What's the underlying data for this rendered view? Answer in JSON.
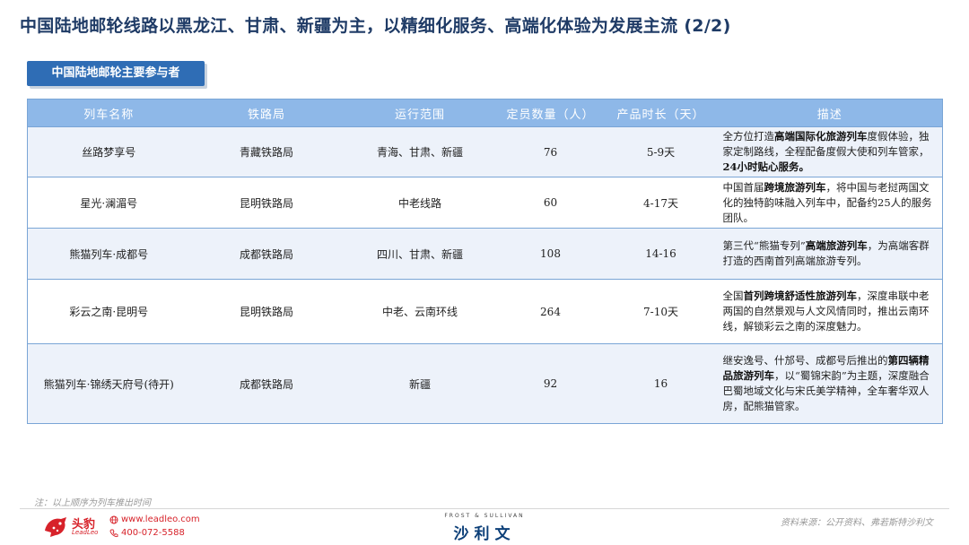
{
  "page": {
    "title": "中国陆地邮轮线路以黑龙江、甘肃、新疆为主，以精细化服务、高端化体验为发展主流 (2/2)",
    "section_label": "中国陆地邮轮主要参与者"
  },
  "table": {
    "headers": [
      "列车名称",
      "铁路局",
      "运行范围",
      "定员数量（人）",
      "产品时长（天）",
      "描述"
    ],
    "rows": [
      {
        "name": "丝路梦享号",
        "bureau": "青藏铁路局",
        "range": "青海、甘肃、新疆",
        "capacity": "76",
        "duration": "5-9天",
        "desc": [
          {
            "t": "全方位打造",
            "b": false
          },
          {
            "t": "高端国际化旅游列车",
            "b": true
          },
          {
            "t": "度假体验，独家定制路线，全程配备度假大使和列车管家，",
            "b": false
          },
          {
            "t": "24小时贴心服务。",
            "b": true
          }
        ]
      },
      {
        "name": "星光·澜湄号",
        "bureau": "昆明铁路局",
        "range": "中老线路",
        "capacity": "60",
        "duration": "4-17天",
        "desc": [
          {
            "t": "中国首届",
            "b": false
          },
          {
            "t": "跨境旅游列车",
            "b": true
          },
          {
            "t": "，将中国与老挝两国文化的独特韵味融入列车中，配备约25人的服务团队。",
            "b": false
          }
        ]
      },
      {
        "name": "熊猫列车·成都号",
        "bureau": "成都铁路局",
        "range": "四川、甘肃、新疆",
        "capacity": "108",
        "duration": "14-16",
        "desc": [
          {
            "t": "第三代“熊猫专列”",
            "b": false
          },
          {
            "t": "高端旅游列车",
            "b": true
          },
          {
            "t": "，为高端客群打造的西南首列高端旅游专列。",
            "b": false
          }
        ]
      },
      {
        "name": "彩云之南·昆明号",
        "bureau": "昆明铁路局",
        "range": "中老、云南环线",
        "capacity": "264",
        "duration": "7-10天",
        "desc": [
          {
            "t": "全国",
            "b": false
          },
          {
            "t": "首列跨境舒适性旅游列车",
            "b": true
          },
          {
            "t": "，深度串联中老两国的自然景观与人文风情同时，推出云南环线，解锁彩云之南的深度魅力。",
            "b": false
          }
        ]
      },
      {
        "name": "熊猫列车·锦绣天府号(待开)",
        "bureau": "成都铁路局",
        "range": "新疆",
        "capacity": "92",
        "duration": "16",
        "desc": [
          {
            "t": "继安逸号、什邡号、成都号后推出的",
            "b": false
          },
          {
            "t": "第四辆精品旅游列车",
            "b": true
          },
          {
            "t": "，以“蜀锦宋韵”为主题，深度融合巴蜀地域文化与宋氏美学精神，全车奢华双人房，配熊猫管家。",
            "b": false
          }
        ]
      }
    ]
  },
  "footer": {
    "note": "注：以上顺序为列车推出时间",
    "brand_name": "头豹",
    "brand_sub": "LeadLeo",
    "website": "www.leadleo.com",
    "phone": "400-072-5588",
    "partner_en": "FROST & SULLIVAN",
    "partner_cn": "沙利文",
    "source": "资料来源：公开资料、弗若斯特沙利文"
  },
  "colors": {
    "title": "#1f3b66",
    "tab": "#2f6db5",
    "header": "#8eb8e8",
    "row_alt": "#edf2fa",
    "brand_red": "#d7222a"
  },
  "icons": [
    "leopard-logo-icon",
    "globe-icon",
    "phone-icon"
  ]
}
